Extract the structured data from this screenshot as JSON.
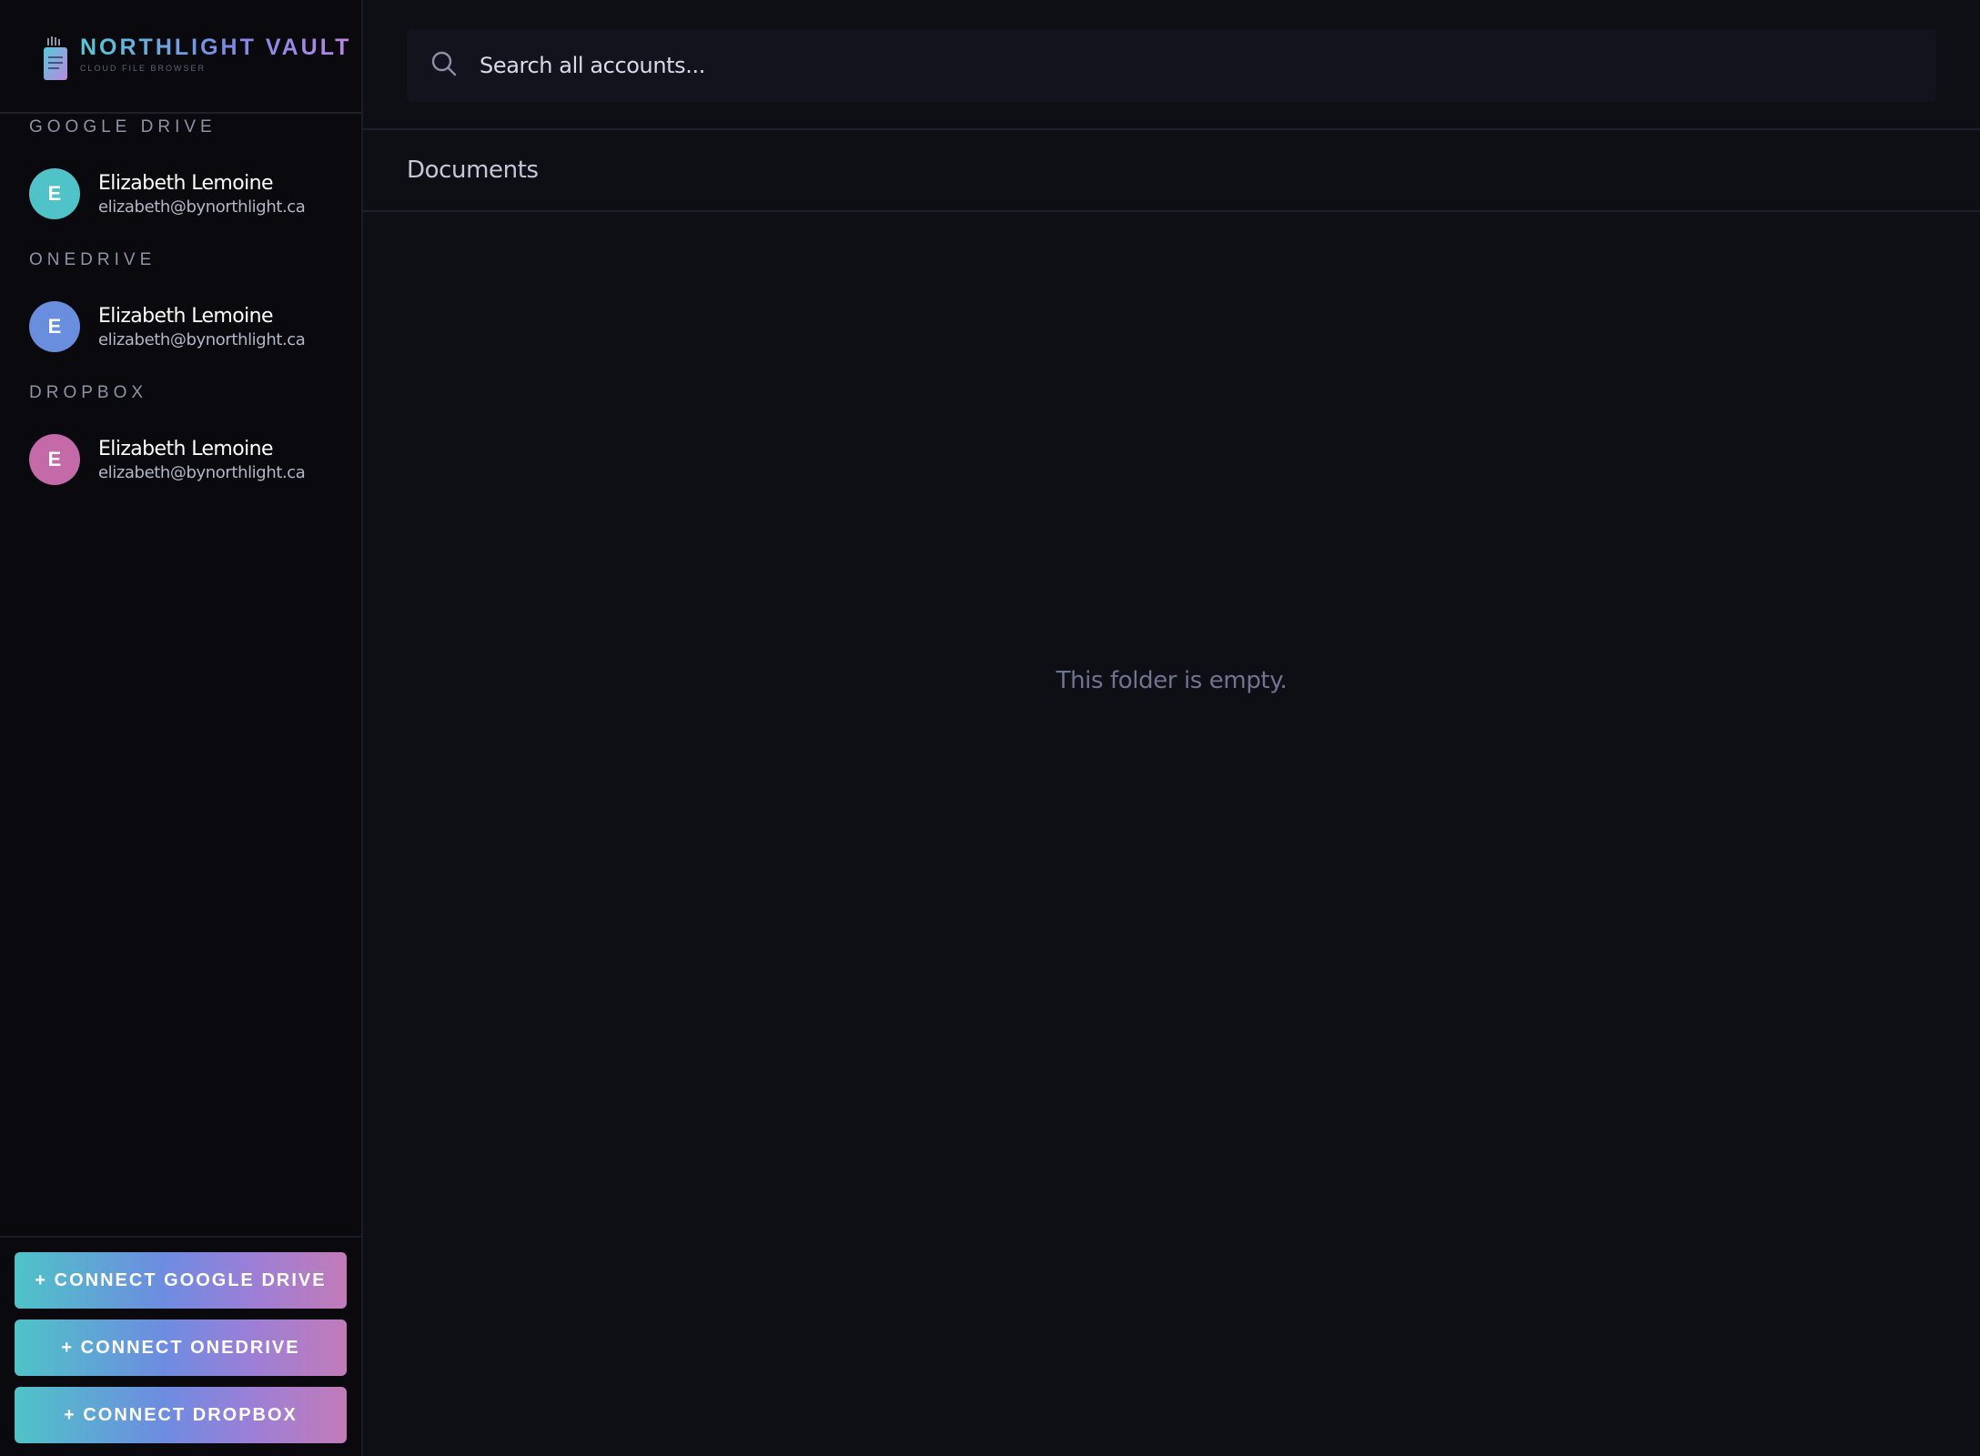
{
  "brand": {
    "name": "NORTHLIGHT VAULT",
    "subtitle": "CLOUD FILE BROWSER"
  },
  "sidebar": {
    "sections": [
      {
        "label": "GOOGLE DRIVE",
        "account": {
          "initial": "E",
          "name": "Elizabeth Lemoine",
          "email": "elizabeth@bynorthlight.ca",
          "color": "#4fc3c8"
        }
      },
      {
        "label": "ONEDRIVE",
        "account": {
          "initial": "E",
          "name": "Elizabeth Lemoine",
          "email": "elizabeth@bynorthlight.ca",
          "color": "#6a8ede"
        }
      },
      {
        "label": "DROPBOX",
        "account": {
          "initial": "E",
          "name": "Elizabeth Lemoine",
          "email": "elizabeth@bynorthlight.ca",
          "color": "#c46aa9"
        }
      }
    ],
    "connect_buttons": [
      "+ CONNECT GOOGLE DRIVE",
      "+ CONNECT ONEDRIVE",
      "+ CONNECT DROPBOX"
    ]
  },
  "search": {
    "placeholder": "Search all accounts...",
    "value": ""
  },
  "breadcrumb": {
    "current": "Documents"
  },
  "content": {
    "empty_message": "This folder is empty."
  },
  "colors": {
    "accent_start": "#4fc3c8",
    "accent_mid": "#6d8ce0",
    "accent_end": "#c27bb8",
    "background": "#0e0e15",
    "sidebar_bg": "#09090e"
  }
}
